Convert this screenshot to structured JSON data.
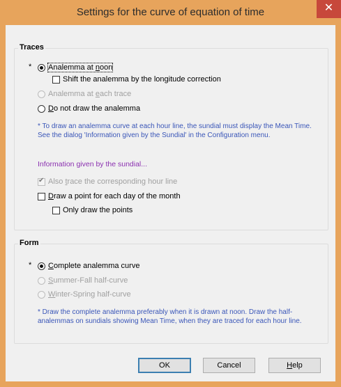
{
  "window": {
    "title": "Settings for the curve of equation of time",
    "close_glyph": "✕"
  },
  "traces": {
    "legend": "Traces",
    "star": "*",
    "analemma_noon": {
      "pre": "Analemma at ",
      "ul": "n",
      "post": "oon",
      "checked": true
    },
    "shift_longitude": "Shift the analemma by the longitude correction",
    "analemma_each": {
      "pre": "Analemma at ",
      "ul": "e",
      "post": "ach trace"
    },
    "do_not_draw": {
      "ul": "D",
      "post": "o not draw the analemma"
    },
    "note": "* To draw an analemma curve at each hour line, the sundial must display the Mean Time. See the dialog 'Information given by the Sundial' in the Configuration menu.",
    "info_link": "Information given by the sundial...",
    "also_trace": {
      "pre": "Also ",
      "ul": "t",
      "post": "race the corresponding hour line",
      "checked": true
    },
    "draw_point": {
      "ul": "D",
      "post": "raw a point for each day of the month"
    },
    "only_points": "Only draw the points"
  },
  "form": {
    "legend": "Form",
    "star": "*",
    "complete": {
      "ul": "C",
      "post": "omplete analemma curve",
      "checked": true
    },
    "summer_fall": {
      "ul": "S",
      "post": "ummer-Fall half-curve"
    },
    "winter_spring": {
      "ul": "W",
      "post": "inter-Spring half-curve"
    },
    "note": "* Draw the complete analemma preferably when it is drawn at noon. Draw the half-analemmas on sundials showing Mean Time, when they are traced for each hour line."
  },
  "buttons": {
    "ok": "OK",
    "cancel": "Cancel",
    "help_ul": "H",
    "help_post": "elp"
  },
  "colors": {
    "titlebar": "#e7a45c",
    "close": "#c7483b",
    "note": "#3a56b8",
    "link": "#8b30b0"
  }
}
